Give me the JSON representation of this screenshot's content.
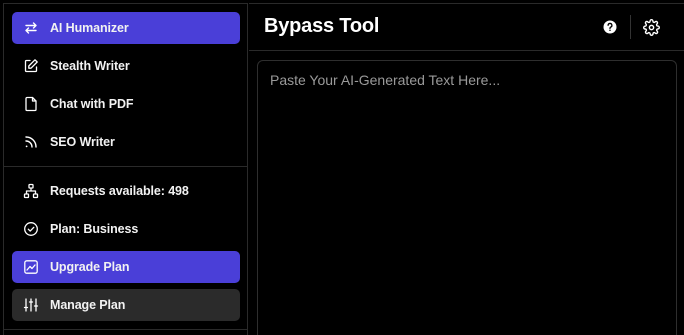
{
  "sidebar": {
    "items": [
      {
        "label": "AI Humanizer",
        "icon": "swap-arrows-icon"
      },
      {
        "label": "Stealth Writer",
        "icon": "edit-icon"
      },
      {
        "label": "Chat with PDF",
        "icon": "file-icon"
      },
      {
        "label": "SEO Writer",
        "icon": "rss-icon"
      }
    ],
    "account": [
      {
        "label": "Requests available: 498",
        "icon": "network-icon"
      },
      {
        "label": "Plan: Business",
        "icon": "check-circle-icon"
      },
      {
        "label": "Upgrade Plan",
        "icon": "trending-up-icon"
      },
      {
        "label": "Manage Plan",
        "icon": "sliders-icon"
      }
    ]
  },
  "header": {
    "title": "Bypass Tool",
    "help_icon": "help-icon",
    "settings_icon": "gear-icon"
  },
  "editor": {
    "placeholder": "Paste Your AI-Generated Text Here...",
    "value": ""
  },
  "colors": {
    "accent": "#4a3fd8",
    "manage_bg": "#2b2b2b",
    "background": "#000000"
  }
}
